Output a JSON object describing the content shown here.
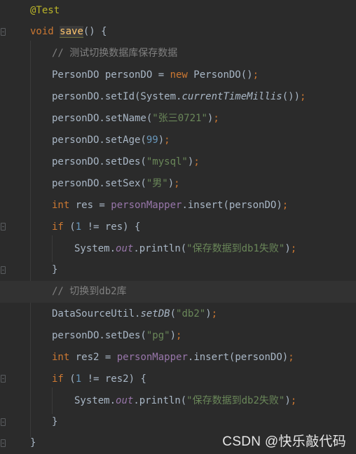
{
  "editor": {
    "language": "java",
    "lines": [
      {
        "tokens": [
          [
            "ann",
            "@Test"
          ]
        ]
      },
      {
        "tokens": [
          [
            "kw",
            "void "
          ],
          [
            "fnsel",
            "save"
          ],
          [
            "p",
            "() {"
          ]
        ]
      },
      {
        "tokens": [
          [
            "cm",
            "// 测试切换数据库保存数据"
          ]
        ]
      },
      {
        "tokens": [
          [
            "p",
            "PersonDO personDO = "
          ],
          [
            "kw",
            "new "
          ],
          [
            "p",
            "PersonDO()"
          ],
          [
            "kw",
            ";"
          ]
        ]
      },
      {
        "tokens": [
          [
            "p",
            "personDO.setId(System."
          ],
          [
            "smeth",
            "currentTimeMillis"
          ],
          [
            "p",
            "())"
          ],
          [
            "kw",
            ";"
          ]
        ]
      },
      {
        "tokens": [
          [
            "p",
            "personDO.setName("
          ],
          [
            "str",
            "\"张三0721\""
          ],
          [
            "p",
            ")"
          ],
          [
            "kw",
            ";"
          ]
        ]
      },
      {
        "tokens": [
          [
            "p",
            "personDO.setAge("
          ],
          [
            "num",
            "99"
          ],
          [
            "p",
            ")"
          ],
          [
            "kw",
            ";"
          ]
        ]
      },
      {
        "tokens": [
          [
            "p",
            "personDO.setDes("
          ],
          [
            "str",
            "\"mysql\""
          ],
          [
            "p",
            ")"
          ],
          [
            "kw",
            ";"
          ]
        ]
      },
      {
        "tokens": [
          [
            "p",
            "personDO.setSex("
          ],
          [
            "str",
            "\"男\""
          ],
          [
            "p",
            ")"
          ],
          [
            "kw",
            ";"
          ]
        ]
      },
      {
        "tokens": [
          [
            "kw",
            "int "
          ],
          [
            "p",
            "res = "
          ],
          [
            "field",
            "personMapper"
          ],
          [
            "p",
            ".insert(personDO)"
          ],
          [
            "kw",
            ";"
          ]
        ]
      },
      {
        "tokens": [
          [
            "kw",
            "if "
          ],
          [
            "p",
            "("
          ],
          [
            "num",
            "1 "
          ],
          [
            "p",
            "!= res) {"
          ]
        ]
      },
      {
        "tokens": [
          [
            "p",
            "System."
          ],
          [
            "static",
            "out"
          ],
          [
            "p",
            ".println("
          ],
          [
            "str",
            "\"保存数据到db1失败\""
          ],
          [
            "p",
            ")"
          ],
          [
            "kw",
            ";"
          ]
        ]
      },
      {
        "tokens": [
          [
            "p",
            "}"
          ]
        ]
      },
      {
        "tokens": [
          [
            "cm",
            "// 切换到db2库"
          ]
        ]
      },
      {
        "tokens": [
          [
            "p",
            "DataSourceUtil."
          ],
          [
            "smeth",
            "setDB"
          ],
          [
            "p",
            "("
          ],
          [
            "str",
            "\"db2\""
          ],
          [
            "p",
            ")"
          ],
          [
            "kw",
            ";"
          ]
        ]
      },
      {
        "tokens": [
          [
            "p",
            "personDO.setDes("
          ],
          [
            "str",
            "\"pg\""
          ],
          [
            "p",
            ")"
          ],
          [
            "kw",
            ";"
          ]
        ]
      },
      {
        "tokens": [
          [
            "kw",
            "int "
          ],
          [
            "p",
            "res2 = "
          ],
          [
            "field",
            "personMapper"
          ],
          [
            "p",
            ".insert(personDO)"
          ],
          [
            "kw",
            ";"
          ]
        ]
      },
      {
        "tokens": [
          [
            "kw",
            "if "
          ],
          [
            "p",
            "("
          ],
          [
            "num",
            "1 "
          ],
          [
            "p",
            "!= res2) {"
          ]
        ]
      },
      {
        "tokens": [
          [
            "p",
            "System."
          ],
          [
            "static",
            "out"
          ],
          [
            "p",
            ".println("
          ],
          [
            "str",
            "\"保存数据到db2失败\""
          ],
          [
            "p",
            ")"
          ],
          [
            "kw",
            ";"
          ]
        ]
      },
      {
        "tokens": [
          [
            "p",
            "}"
          ]
        ]
      },
      {
        "tokens": [
          [
            "p",
            "}"
          ]
        ]
      }
    ]
  },
  "gutter": {
    "bulb_icon": "intention-bulb-icon"
  },
  "watermark": "CSDN @快乐敲代码"
}
